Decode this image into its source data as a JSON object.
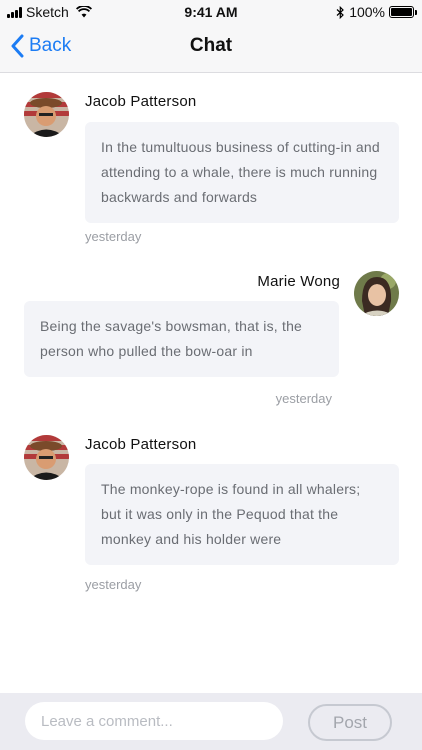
{
  "status_bar": {
    "carrier": "Sketch",
    "time": "9:41 AM",
    "battery": "100%"
  },
  "nav": {
    "back_label": "Back",
    "title": "Chat"
  },
  "messages": [
    {
      "sender": "Jacob Patterson",
      "text": "In the tumultuous business of cutting-in and attending to a whale, there is much running backwards and forwards",
      "time": "yesterday",
      "side": "left"
    },
    {
      "sender": "Marie Wong",
      "text": "Being the savage's bowsman, that is, the person who pulled the bow-oar in",
      "time": "yesterday",
      "side": "right"
    },
    {
      "sender": "Jacob Patterson",
      "text": "The monkey-rope is found in all whalers; but it was only in the Pequod that the monkey and his holder were",
      "time": "yesterday",
      "side": "left"
    }
  ],
  "composer": {
    "placeholder": "Leave a comment...",
    "post_label": "Post"
  },
  "colors": {
    "accent": "#1c7cf4",
    "bubble_bg": "#f3f4f8",
    "composer_bg": "#ebebf1"
  }
}
